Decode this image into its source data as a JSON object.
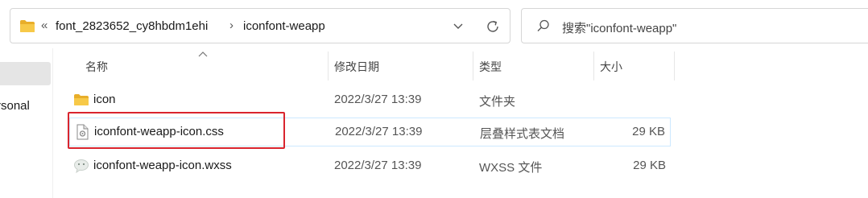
{
  "address_bar": {
    "overflow_label": "«",
    "crumbs": [
      "font_2823652_cy8hbdm1ehi",
      "iconfont-weapp"
    ],
    "separator": "›"
  },
  "search": {
    "placeholder": "搜索\"iconfont-weapp\""
  },
  "nav": {
    "item_partial": "rsonal"
  },
  "columns": {
    "name": "名称",
    "date": "修改日期",
    "type": "类型",
    "size": "大小"
  },
  "files": [
    {
      "name": "icon",
      "date": "2022/3/27 13:39",
      "type": "文件夹",
      "size": "",
      "icon": "folder-icon"
    },
    {
      "name": "iconfont-weapp-icon.css",
      "date": "2022/3/27 13:39",
      "type": "层叠样式表文档",
      "size": "29 KB",
      "icon": "css-file-icon",
      "selected": true
    },
    {
      "name": "iconfont-weapp-icon.wxss",
      "date": "2022/3/27 13:39",
      "type": "WXSS 文件",
      "size": "29 KB",
      "icon": "wechat-file-icon"
    }
  ],
  "colors": {
    "highlight": "#d9252e",
    "folder": "#f4c242",
    "selection_border": "#cde8ff"
  }
}
